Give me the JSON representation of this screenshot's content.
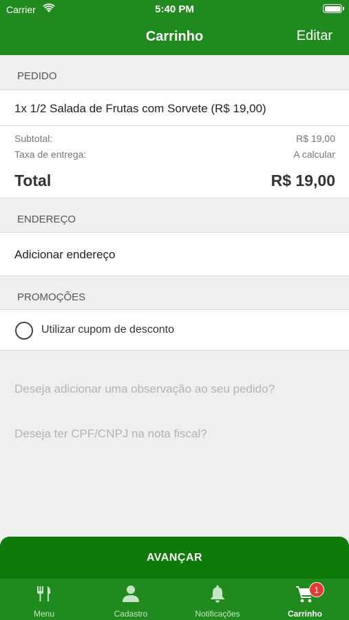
{
  "status_bar": {
    "carrier": "Carrier",
    "time": "5:40 PM"
  },
  "nav": {
    "title": "Carrinho",
    "edit_label": "Editar"
  },
  "order": {
    "section_label": "PEDIDO",
    "item": "1x 1/2 Salada de Frutas com Sorvete (R$ 19,00)",
    "subtotal_label": "Subtotal:",
    "subtotal_value": "R$ 19,00",
    "delivery_label": "Taxa de entrega:",
    "delivery_value": "A calcular",
    "total_label": "Total",
    "total_value": "R$ 19,00"
  },
  "address": {
    "section_label": "ENDEREÇO",
    "add_label": "Adicionar endereço"
  },
  "promotions": {
    "section_label": "PROMOÇÕES",
    "coupon_label": "Utilizar cupom de desconto"
  },
  "questions": {
    "observation": "Deseja adicionar uma observação ao seu pedido?",
    "tax_id": "Deseja ter CPF/CNPJ na nota fiscal?"
  },
  "advance_button": "AVANÇAR",
  "tabs": [
    {
      "label": "Menu",
      "icon": "fork-knife-icon"
    },
    {
      "label": "Cadastro",
      "icon": "person-icon"
    },
    {
      "label": "Notificações",
      "icon": "bell-icon"
    },
    {
      "label": "Carrinho",
      "icon": "cart-icon",
      "active": true
    }
  ],
  "cart_badge": "1",
  "colors": {
    "brand_green": "#218a1f",
    "button_green": "#0d7a0a",
    "badge_red": "#e53935"
  }
}
